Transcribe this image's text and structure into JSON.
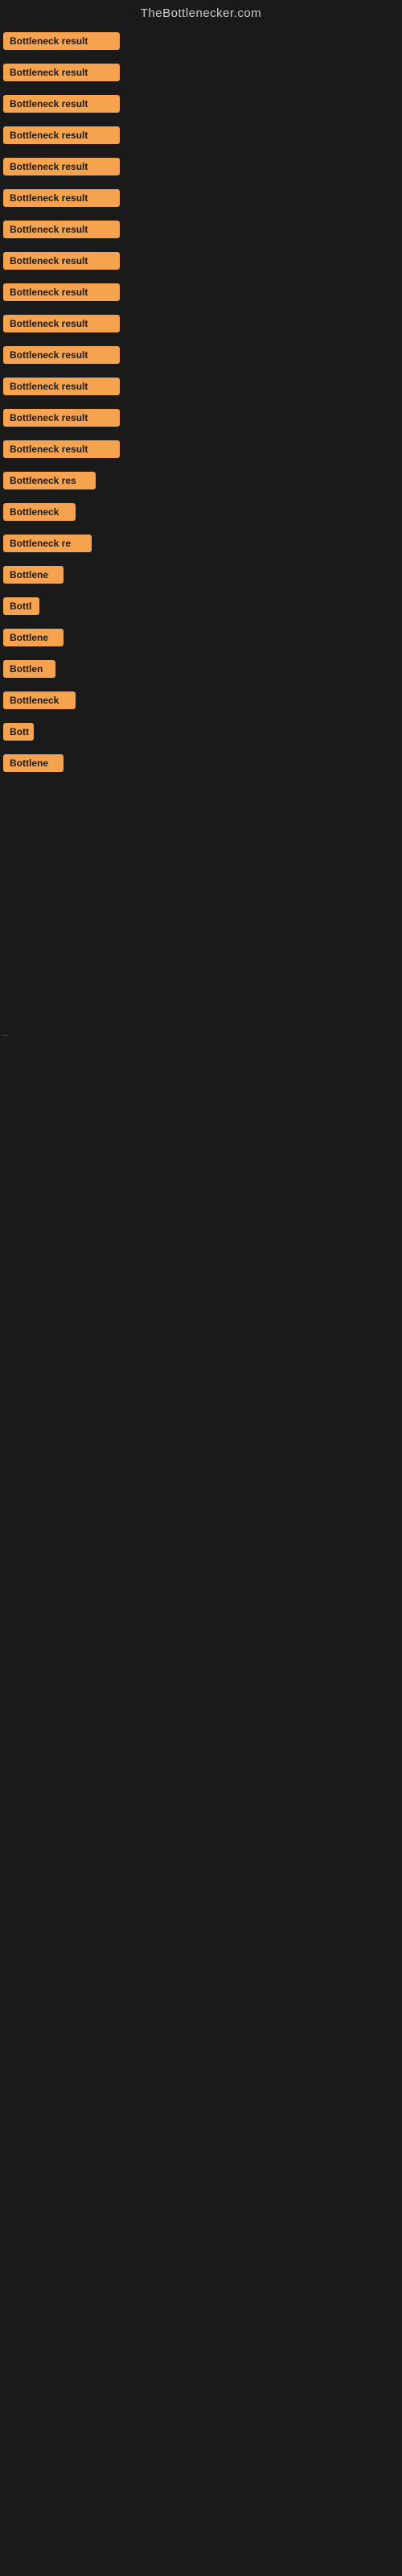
{
  "header": {
    "title": "TheBottlenecker.com"
  },
  "accent_color": "#f5a34f",
  "results": [
    {
      "id": 1,
      "label": "Bottleneck result",
      "width": "full"
    },
    {
      "id": 2,
      "label": "Bottleneck result",
      "width": "full"
    },
    {
      "id": 3,
      "label": "Bottleneck result",
      "width": "full"
    },
    {
      "id": 4,
      "label": "Bottleneck result",
      "width": "full"
    },
    {
      "id": 5,
      "label": "Bottleneck result",
      "width": "full"
    },
    {
      "id": 6,
      "label": "Bottleneck result",
      "width": "full"
    },
    {
      "id": 7,
      "label": "Bottleneck result",
      "width": "full"
    },
    {
      "id": 8,
      "label": "Bottleneck result",
      "width": "full"
    },
    {
      "id": 9,
      "label": "Bottleneck result",
      "width": "full"
    },
    {
      "id": 10,
      "label": "Bottleneck result",
      "width": "full"
    },
    {
      "id": 11,
      "label": "Bottleneck result",
      "width": "full"
    },
    {
      "id": 12,
      "label": "Bottleneck result",
      "width": "full"
    },
    {
      "id": 13,
      "label": "Bottleneck result",
      "width": "full"
    },
    {
      "id": 14,
      "label": "Bottleneck result",
      "width": "full"
    },
    {
      "id": 15,
      "label": "Bottleneck res",
      "width": "partial-lg"
    },
    {
      "id": 16,
      "label": "Bottleneck",
      "width": "partial-md"
    },
    {
      "id": 17,
      "label": "Bottleneck re",
      "width": "partial-lg2"
    },
    {
      "id": 18,
      "label": "Bottlene",
      "width": "partial-sm"
    },
    {
      "id": 19,
      "label": "Bottl",
      "width": "tiny"
    },
    {
      "id": 20,
      "label": "Bottlene",
      "width": "partial-sm"
    },
    {
      "id": 21,
      "label": "Bottlen",
      "width": "partial-xs"
    },
    {
      "id": 22,
      "label": "Bottleneck",
      "width": "partial-md"
    },
    {
      "id": 23,
      "label": "Bott",
      "width": "xtiny"
    },
    {
      "id": 24,
      "label": "Bottlene",
      "width": "partial-sm"
    }
  ],
  "dot_label": "..."
}
